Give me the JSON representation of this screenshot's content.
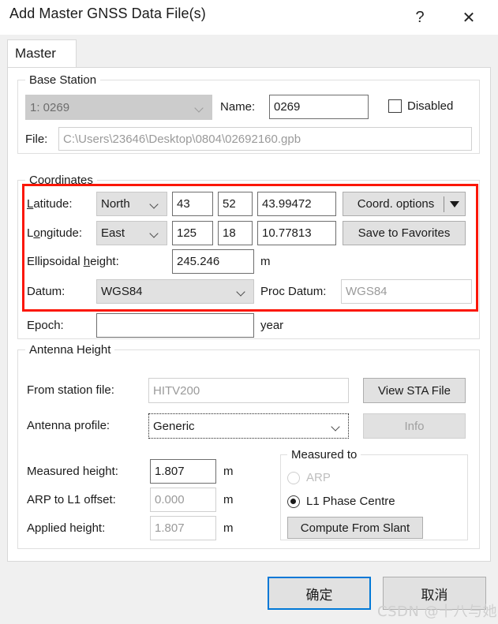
{
  "window": {
    "title": "Add Master GNSS Data File(s)",
    "help_icon": "?",
    "close_icon": "✕"
  },
  "tabs": [
    {
      "label": "Master",
      "selected": true
    }
  ],
  "base_station": {
    "group_title": "Base Station",
    "station_select_value": "1: 0269",
    "name_label": "Name:",
    "name_value": "0269",
    "disabled_checkbox_label": "Disabled",
    "disabled_checked": false,
    "file_label": "File:",
    "file_value": "C:\\Users\\23646\\Desktop\\0804\\02692160.gpb"
  },
  "coordinates": {
    "group_title": "Coordinates",
    "latitude_label": "Latitude:",
    "latitude_hemisphere": "North",
    "latitude_deg": "43",
    "latitude_min": "52",
    "latitude_sec": "43.99472",
    "longitude_label": "Longitude:",
    "longitude_hemisphere": "East",
    "longitude_deg": "125",
    "longitude_min": "18",
    "longitude_sec": "10.77813",
    "coord_options_button": "Coord. options",
    "save_favorites_button": "Save to Favorites",
    "ellipsoidal_height_label": "Ellipsoidal height:",
    "ellipsoidal_height_value": "245.246",
    "ellipsoidal_height_unit": "m",
    "datum_label": "Datum:",
    "datum_value": "WGS84",
    "proc_datum_label": "Proc Datum:",
    "proc_datum_value": "WGS84",
    "epoch_label": "Epoch:",
    "epoch_value": "",
    "epoch_unit": "year"
  },
  "antenna_height": {
    "group_title": "Antenna Height",
    "from_station_file_label": "From station file:",
    "from_station_file_value": "HITV200",
    "view_sta_file_button": "View STA File",
    "antenna_profile_label": "Antenna profile:",
    "antenna_profile_value": "Generic",
    "info_button": "Info",
    "measured_height_label": "Measured height:",
    "measured_height_value": "1.807",
    "measured_height_unit": "m",
    "arp_to_l1_label": "ARP to L1 offset:",
    "arp_to_l1_value": "0.000",
    "arp_to_l1_unit": "m",
    "applied_height_label": "Applied height:",
    "applied_height_value": "1.807",
    "applied_height_unit": "m",
    "measured_to": {
      "group_title": "Measured to",
      "options": [
        {
          "label": "ARP",
          "selected": false,
          "disabled": true
        },
        {
          "label": "L1 Phase Centre",
          "selected": true,
          "disabled": false
        }
      ],
      "compute_from_slant_button": "Compute From Slant"
    }
  },
  "footer": {
    "ok_button": "确定",
    "cancel_button": "取消"
  },
  "annotation": {
    "highlight_color": "#fb1707"
  },
  "watermark": "CSDN @十八与她"
}
